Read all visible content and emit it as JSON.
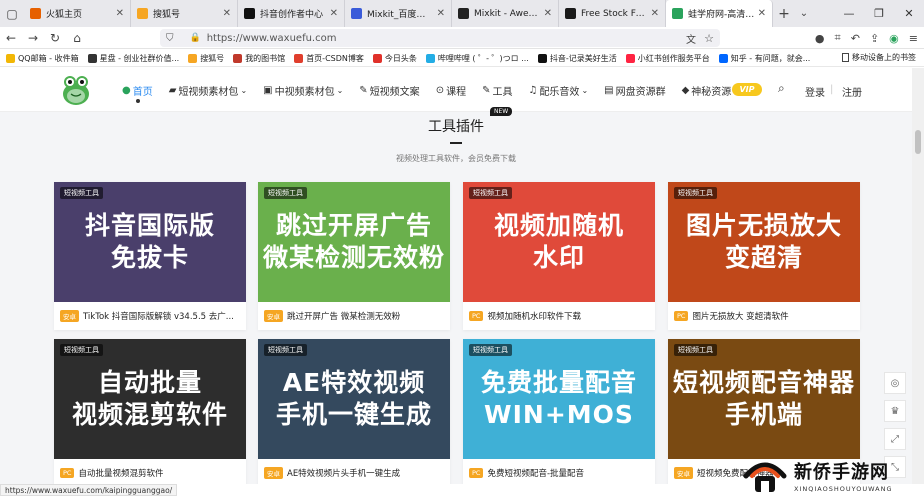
{
  "browser": {
    "tabs": [
      {
        "title": "火狐主页",
        "color": "#e66000",
        "active": false
      },
      {
        "title": "搜狐号",
        "color": "#f6a623",
        "active": false
      },
      {
        "title": "抖音创作者中心",
        "color": "#111111",
        "active": false
      },
      {
        "title": "Mixkit_百度搜索",
        "color": "#3a5bd9",
        "active": false
      },
      {
        "title": "Mixkit - Awesome free",
        "color": "#222222",
        "active": false
      },
      {
        "title": "Free Stock Footage Vid",
        "color": "#1a1a1a",
        "active": false
      },
      {
        "title": "蛙学府网-高清视频素材",
        "color": "#2aa35c",
        "active": true
      }
    ],
    "url": "https://www.waxuefu.com",
    "bookmarks": [
      {
        "label": "QQ邮箱 - 收件箱",
        "color": "#f2b705"
      },
      {
        "label": "星盘 - 创业社群价值...",
        "color": "#333333"
      },
      {
        "label": "搜狐号",
        "color": "#f6a623"
      },
      {
        "label": "我的图书馆",
        "color": "#c0392b"
      },
      {
        "label": "首页-CSDN博客",
        "color": "#e03e2d"
      },
      {
        "label": "今日头条",
        "color": "#e0312a"
      },
      {
        "label": "哔哩哔哩 ( ゜- ゜)つロ ...",
        "color": "#23ade5"
      },
      {
        "label": "抖音-记录美好生活",
        "color": "#111111"
      },
      {
        "label": "小红书创作服务平台",
        "color": "#ff2442"
      },
      {
        "label": "知乎 - 有问题，就会...",
        "color": "#0066ff"
      }
    ],
    "mobile_bookmarks": "移动设备上的书签",
    "status_url": "https://www.waxuefu.com/kaipingguanggao/"
  },
  "site": {
    "nav": [
      {
        "icon": "home-icon",
        "glyph": "●",
        "label": "首页"
      },
      {
        "icon": "video-icon",
        "glyph": "▰",
        "label": "短视频素材包"
      },
      {
        "icon": "film-icon",
        "glyph": "▣",
        "label": "中视频素材包"
      },
      {
        "icon": "pen-icon",
        "glyph": "✎",
        "label": "短视频文案"
      },
      {
        "icon": "course-icon",
        "glyph": "⊙",
        "label": "课程"
      },
      {
        "icon": "tool-icon",
        "glyph": "✎",
        "label": "工具"
      },
      {
        "icon": "music-icon",
        "glyph": "♫",
        "label": "配乐音效"
      },
      {
        "icon": "cloud-icon",
        "glyph": "▤",
        "label": "网盘资源群"
      },
      {
        "icon": "gift-icon",
        "glyph": "◆",
        "label": "神秘资源"
      }
    ],
    "vip": "VIP",
    "login": "登录",
    "separator": "|",
    "register": "注册"
  },
  "section": {
    "title": "工具插件",
    "new_badge": "NEW",
    "subtitle": "视频处理工具软件，会员免费下载"
  },
  "cards": [
    {
      "tag": "短视频工具",
      "thumb_line1": "抖音国际版",
      "thumb_line2": "免拔卡",
      "bg": "#4a3f6b",
      "badge": "安卓",
      "title": "TikTok 抖音国际版解锁 v34.5.5 去广..."
    },
    {
      "tag": "短视频工具",
      "thumb_line1": "跳过开屏广告",
      "thumb_line2": "微某检测无效粉",
      "bg": "#6ab04c",
      "badge": "安卓",
      "title": "跳过开屏广告 微某检测无效粉"
    },
    {
      "tag": "短视频工具",
      "thumb_line1": "视频加随机",
      "thumb_line2": "水印",
      "bg": "#e04a3a",
      "badge": "PC",
      "title": "视频加随机水印软件下载"
    },
    {
      "tag": "短视频工具",
      "thumb_line1": "图片无损放大",
      "thumb_line2": "变超清",
      "bg": "#c0481a",
      "badge": "PC",
      "title": "图片无损放大 变超清软件"
    },
    {
      "tag": "短视频工具",
      "thumb_line1": "自动批量",
      "thumb_line2": "视频混剪软件",
      "bg": "#2d2d2d",
      "badge": "PC",
      "title": "自动批量视频混剪软件"
    },
    {
      "tag": "短视频工具",
      "thumb_line1": "AE特效视频",
      "thumb_line2": "手机一键生成",
      "bg": "#34495e",
      "badge": "安卓",
      "title": "AE特效视频片头手机一键生成"
    },
    {
      "tag": "短视频工具",
      "thumb_line1": "免费批量配音",
      "thumb_line2": "WIN+MOS",
      "bg": "#3fb0d6",
      "badge": "PC",
      "title": "免费短视频配音-批量配音"
    },
    {
      "tag": "短视频工具",
      "thumb_line1": "短视频配音神器",
      "thumb_line2": "手机端",
      "bg": "#7a4a12",
      "badge": "安卓",
      "title": "短视频免费配音神器"
    }
  ],
  "watermark": {
    "name": "新侨手游网",
    "domain": "XINQIAOSHOUYOUWANG"
  }
}
